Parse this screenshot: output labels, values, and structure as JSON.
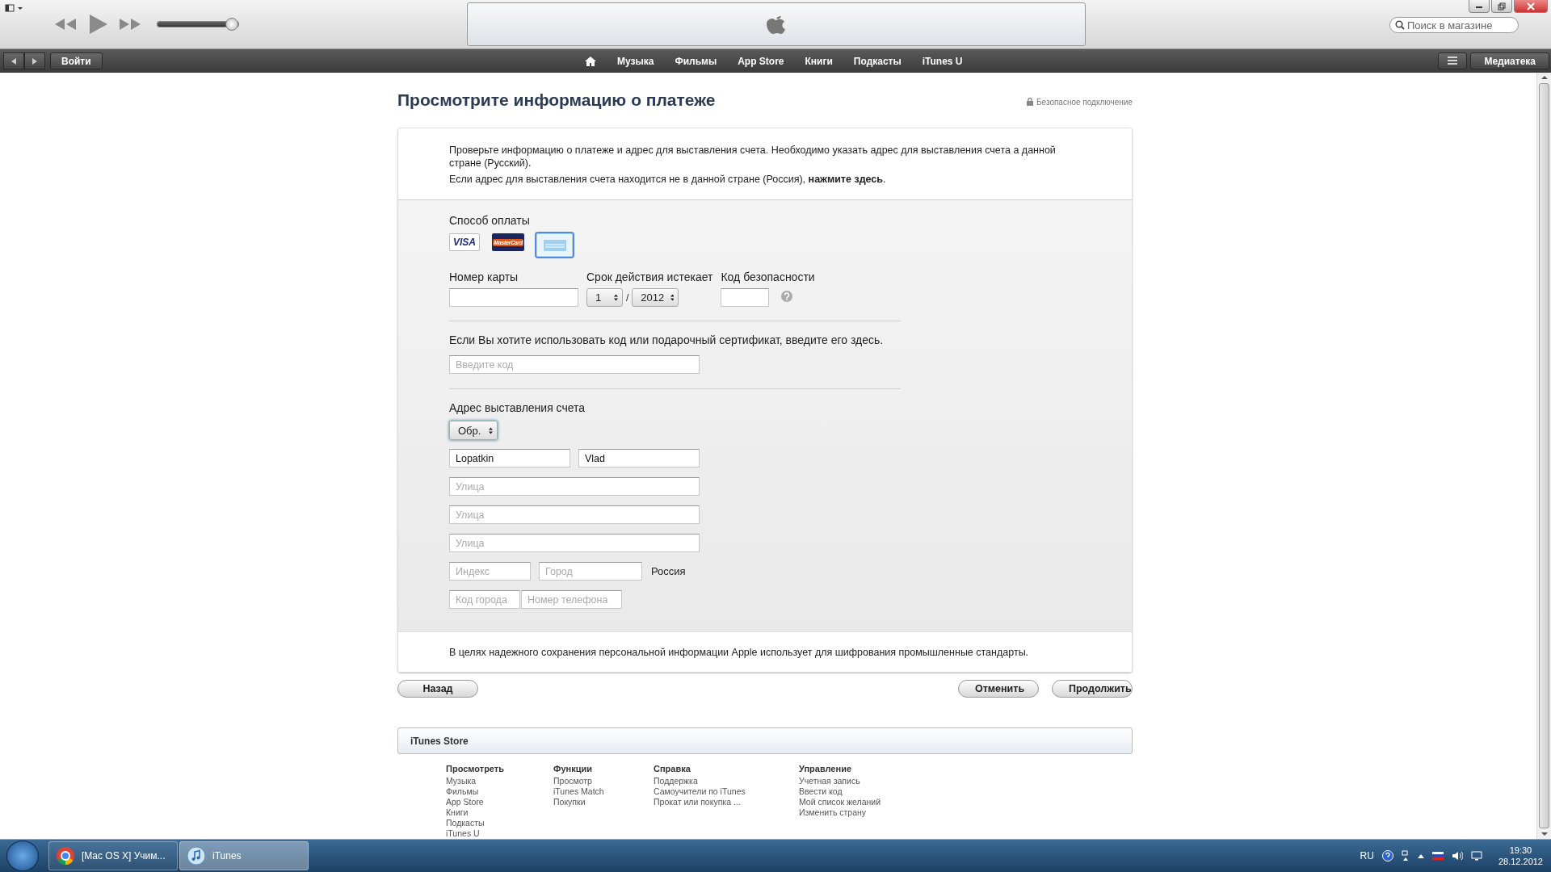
{
  "toolbar": {
    "search": {
      "placeholder": "Поиск в магазине"
    },
    "volume": {
      "level": 0.92
    }
  },
  "navbar": {
    "signin": "Войти",
    "links": [
      "Музыка",
      "Фильмы",
      "App Store",
      "Книги",
      "Подкасты",
      "iTunes U"
    ],
    "library": "Медиатека"
  },
  "page": {
    "title": "Просмотрите информацию о платеже",
    "secure": "Безопасное подключение",
    "intro": [
      "Проверьте информацию о платеже и адрес для выставления счета. Необходимо указать адрес для выставления счета а данной стране (Русский).",
      "Если адрес для выставления счета находится не в данной стране (Россия), **нажмите здесь**."
    ],
    "payment": {
      "label": "Способ оплаты",
      "cards": [
        {
          "kind": "visa",
          "label": "VISA",
          "selected": false
        },
        {
          "kind": "mastercard",
          "label": "MasterCard",
          "selected": false
        },
        {
          "kind": "amex",
          "selected": true
        }
      ],
      "card_number_label": "Номер карты",
      "expiry_label": "Срок действия истекает",
      "month": "1",
      "separator": "/",
      "year": "2012",
      "security_label": "Код безопасности"
    },
    "gift": {
      "prompt": "Если Вы хотите использовать код или подарочный сертификат, введите его здесь.",
      "placeholder": "Введите код"
    },
    "address": {
      "label": "Адрес выставления счета",
      "salutation": "Обр.",
      "last_name": "Lopatkin",
      "first_name": "Vlad",
      "streets": [
        {
          "placeholder": "Улица"
        },
        {
          "placeholder": "Улица"
        },
        {
          "placeholder": "Улица"
        }
      ],
      "postcode": {
        "placeholder": "Индекс"
      },
      "city": {
        "placeholder": "Город"
      },
      "country": "Россия",
      "area_code": {
        "placeholder": "Код города"
      },
      "phone": {
        "placeholder": "Номер телефона"
      }
    },
    "notice": "В целях надежного сохранения персональной информации Apple использует для шифрования промышленные стандарты.",
    "buttons": {
      "back": "Назад",
      "cancel": "Отменить",
      "continue": "Продолжить"
    }
  },
  "footer": {
    "title": "iTunes Store",
    "columns": [
      {
        "heading": "Просмотреть",
        "links": [
          "Музыка",
          "Фильмы",
          "App Store",
          "Книги",
          "Подкасты",
          "iTunes U"
        ]
      },
      {
        "heading": "Функции",
        "links": [
          "Просмотр",
          "iTunes Match",
          "Покупки"
        ]
      },
      {
        "heading": "Справка",
        "links": [
          "Поддержка",
          "Самоучители по iTunes",
          "Прокат или покупка ..."
        ]
      },
      {
        "heading": "Управление",
        "links": [
          "Учетная запись",
          "Ввести код",
          "Мой список желаний",
          "Изменить страну"
        ]
      }
    ]
  },
  "taskbar": {
    "tasks": [
      {
        "kind": "browser",
        "label": "[Mac OS X] Учим...",
        "selected": false
      },
      {
        "kind": "music",
        "label": "iTunes",
        "selected": true
      }
    ],
    "language": "RU",
    "time": "19:30",
    "date": "28.12.2012"
  }
}
